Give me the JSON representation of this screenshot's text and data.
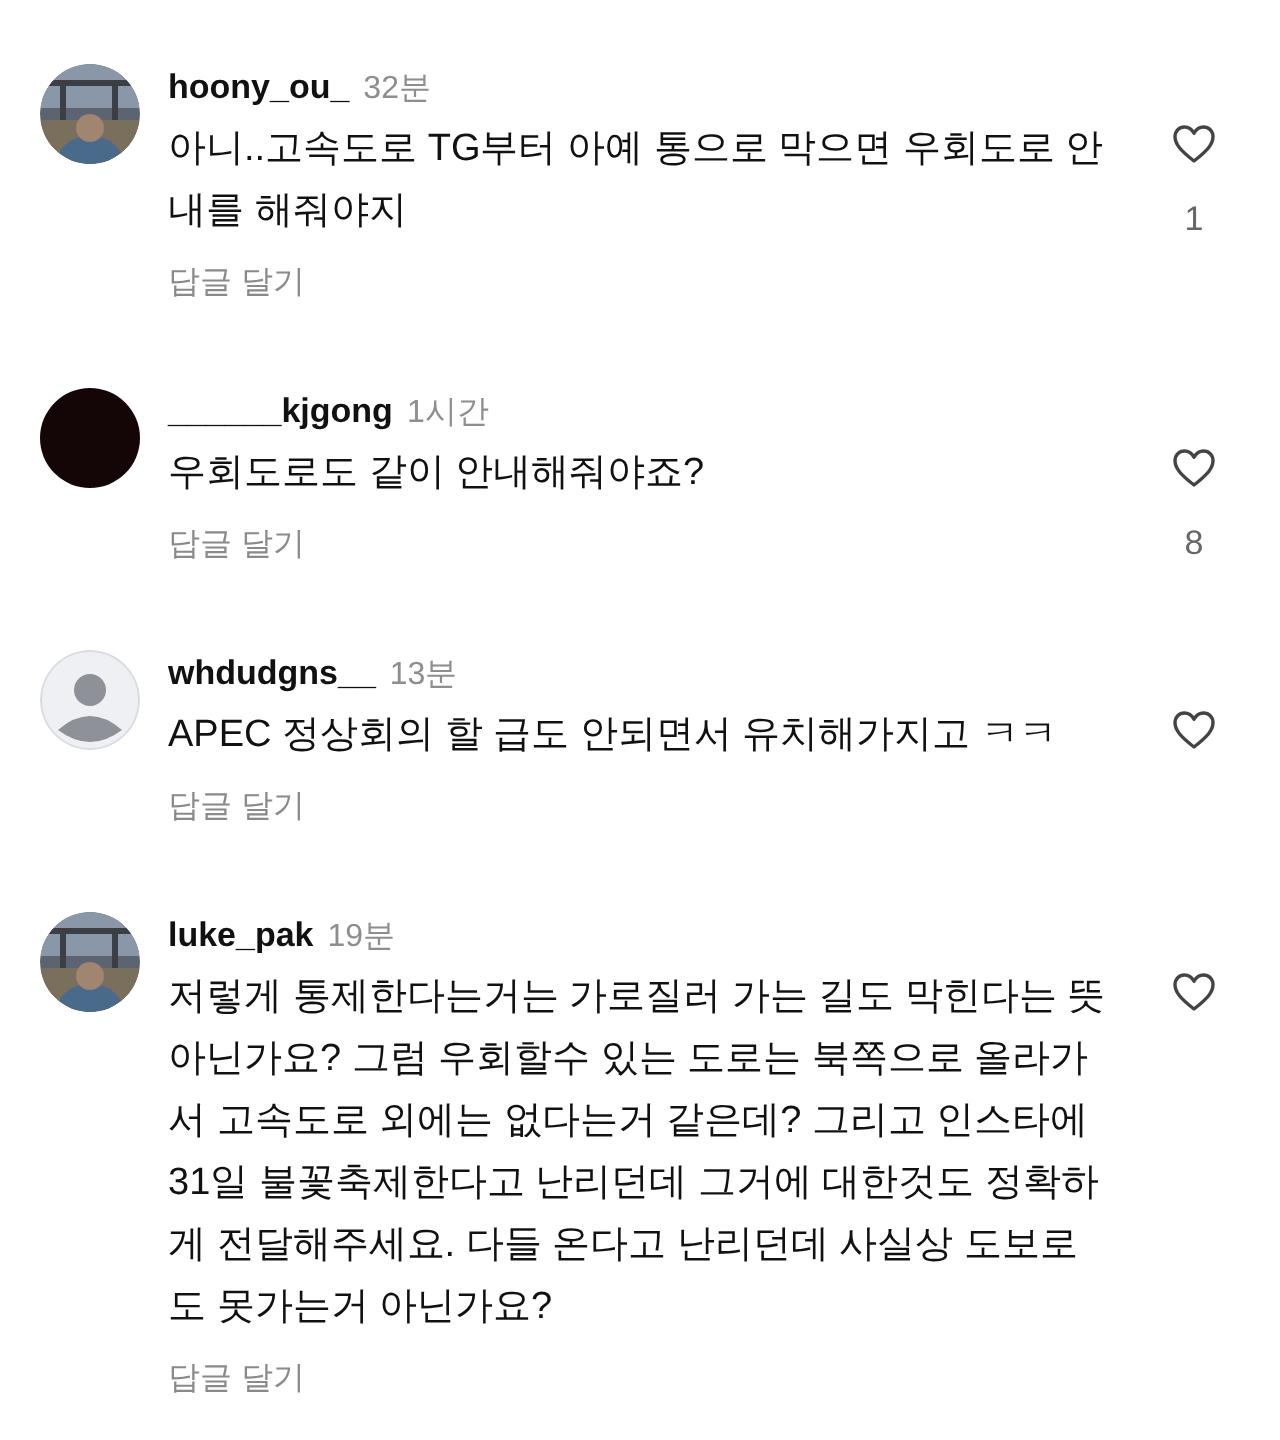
{
  "comments": [
    {
      "username": "hoony_ou_",
      "time": "32분",
      "text": "아니..고속도로 TG부터 아예 통으로 막으면 우회도로 안내를 해줘야지",
      "reply": "답글 달기",
      "likes": "1"
    },
    {
      "avatar": {
        "kind": "solid",
        "color": "#140607"
      },
      "username": "______kjgong",
      "time": "1시간",
      "text": "우회도로도 같이 안내해줘야죠?",
      "reply": "답글 달기",
      "likes": "8"
    },
    {
      "avatar": {
        "kind": "default"
      },
      "username": "whdudgns__",
      "time": "13분",
      "text": "APEC 정상회의 할 급도 안되면서 유치해가지고 ㅋㅋ",
      "reply": "답글 달기"
    },
    {
      "username": "luke_pak",
      "time": "19분",
      "text": "저렇게 통제한다는거는 가로질러 가는 길도 막힌다는 뜻아닌가요? 그럼 우회할수 있는 도로는 북쪽으로 올라가서 고속도로 외에는 없다는거 같은데? 그리고 인스타에 31일 불꽃축제한다고 난리던데 그거에 대한것도 정확하게 전달해주세요. 다들 온다고 난리던데 사실상 도보로도 못가는거 아닌가요?",
      "reply": "답글 달기"
    }
  ]
}
